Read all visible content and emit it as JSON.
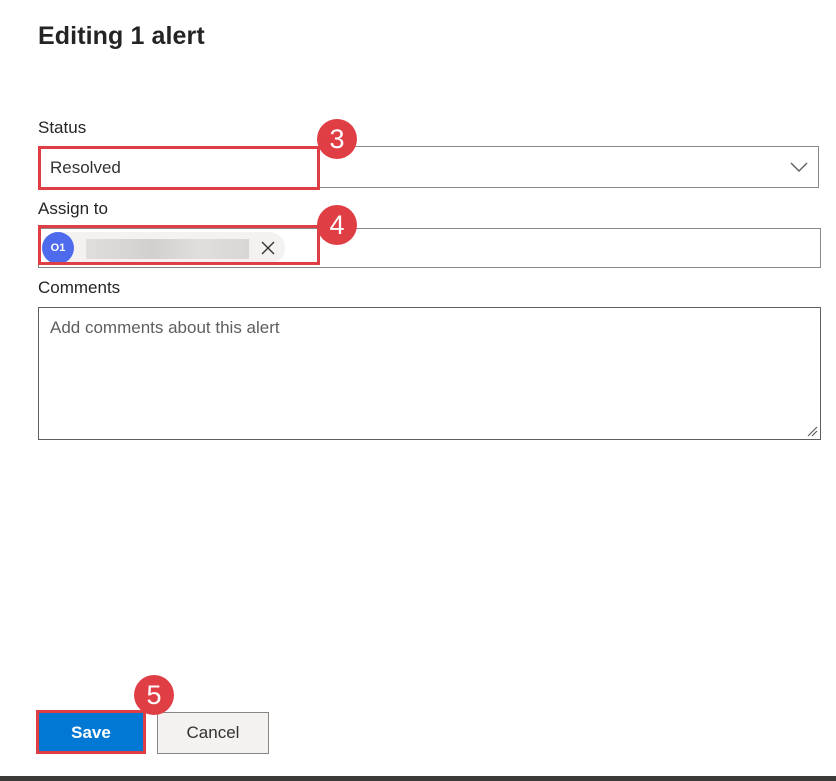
{
  "panel": {
    "title": "Editing 1 alert"
  },
  "status": {
    "label": "Status",
    "selected": "Resolved"
  },
  "assign": {
    "label": "Assign to",
    "avatar_initials": "O1",
    "assignee_name": "redacted"
  },
  "comments": {
    "label": "Comments",
    "placeholder": "Add comments about this alert",
    "value": ""
  },
  "actions": {
    "save_label": "Save",
    "cancel_label": "Cancel"
  },
  "annotations": {
    "status_step": "3",
    "assign_step": "4",
    "save_step": "5"
  },
  "colors": {
    "accent": "#0078d4",
    "callout": "#e03e45",
    "avatar": "#4f6bed"
  },
  "icons": {
    "dropdown": "chevron-down-icon",
    "remove_assignee": "close-icon",
    "resize": "resize-grip-icon"
  }
}
